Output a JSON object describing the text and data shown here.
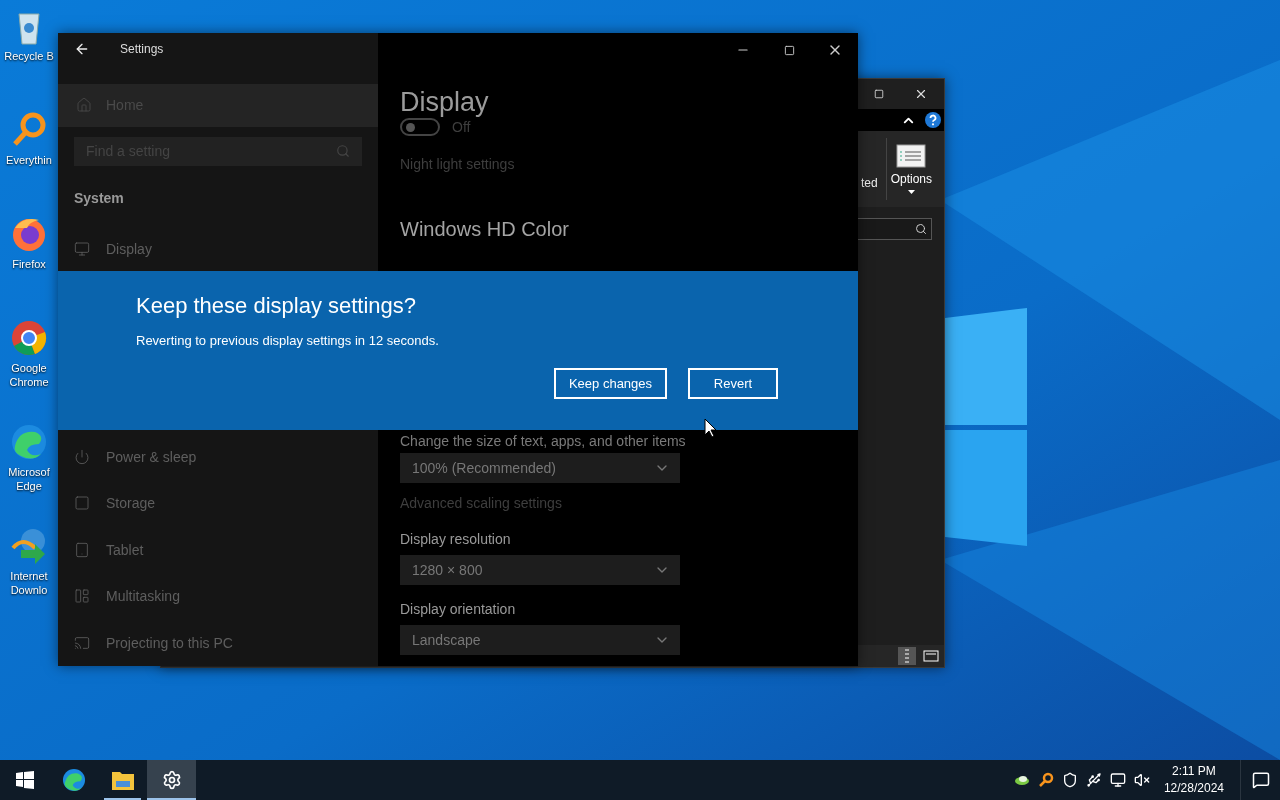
{
  "desktop_icons": [
    {
      "kind": "recycle-bin",
      "label": "Recycle B"
    },
    {
      "kind": "magnifier",
      "label": "Everythin"
    },
    {
      "kind": "firefox",
      "label": "Firefox"
    },
    {
      "kind": "chrome",
      "label": "Google Chrome"
    },
    {
      "kind": "edge",
      "label": "Microsof Edge"
    },
    {
      "kind": "downloader",
      "label": "Internet Downlo"
    }
  ],
  "explorer": {
    "ribbon_label": "ted",
    "options_button": "Options"
  },
  "settings": {
    "title": "Settings",
    "sidebar": {
      "home": "Home",
      "search_placeholder": "Find a setting",
      "section": "System",
      "items": [
        {
          "kind": "monitor",
          "label": "Display",
          "selected": false
        }
      ],
      "more_items": [
        {
          "kind": "power",
          "label": "Power & sleep",
          "selected": false
        },
        {
          "kind": "storage",
          "label": "Storage",
          "selected": false
        },
        {
          "kind": "tablet",
          "label": "Tablet",
          "selected": false
        },
        {
          "kind": "multitasking",
          "label": "Multitasking",
          "selected": false
        },
        {
          "kind": "projecting",
          "label": "Projecting to this PC",
          "selected": false
        }
      ]
    },
    "page_title": "Display",
    "night_light": {
      "on": false,
      "state_label": "Off"
    },
    "night_light_link": "Night light settings",
    "hd_color_heading": "Windows HD Color",
    "scale_label": "Change the size of text, apps, and other items",
    "scale_value": "100% (Recommended)",
    "advanced_link": "Advanced scaling settings",
    "resolution_label": "Display resolution",
    "resolution_value": "1280 × 800",
    "orientation_label": "Display orientation",
    "orientation_value": "Landscape"
  },
  "dialog": {
    "title": "Keep these display settings?",
    "message": "Reverting to previous display settings in 12 seconds.",
    "buttons": [
      "Keep changes",
      "Revert"
    ]
  },
  "taskbar": {
    "apps": [
      {
        "kind": "edge",
        "running": false,
        "selected": false
      },
      {
        "kind": "folder",
        "running": true,
        "selected": false
      },
      {
        "kind": "gear",
        "running": true,
        "selected": true
      }
    ],
    "time": "2:11 PM",
    "date": "12/28/2024"
  }
}
